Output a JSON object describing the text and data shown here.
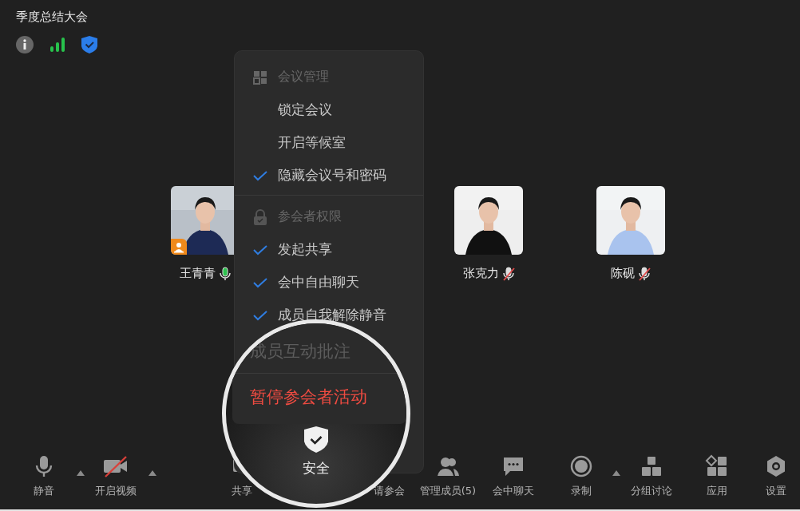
{
  "meeting": {
    "title": "季度总结大会"
  },
  "participants": [
    {
      "name": "王青青",
      "host": true,
      "muted": false
    },
    {
      "name": "张克力",
      "host": false,
      "muted": true
    },
    {
      "name": "陈砚",
      "host": false,
      "muted": true
    }
  ],
  "security_menu": {
    "sections": [
      {
        "kind": "grid",
        "header": "会议管理",
        "items": [
          {
            "label": "锁定会议",
            "checked": false
          },
          {
            "label": "开启等候室",
            "checked": false
          },
          {
            "label": "隐藏会议号和密码",
            "checked": true
          }
        ]
      },
      {
        "kind": "lock",
        "header": "参会者权限",
        "items": [
          {
            "label": "发起共享",
            "checked": true
          },
          {
            "label": "会中自由聊天",
            "checked": true
          },
          {
            "label": "成员自我解除静音",
            "checked": true
          }
        ]
      }
    ]
  },
  "magnifier": {
    "items": [
      {
        "label": "成员互动批注",
        "kind": "disabled"
      },
      {
        "label": "暂停参会者活动",
        "kind": "danger"
      }
    ],
    "button": {
      "label": "安全"
    }
  },
  "toolbar": {
    "left": [
      {
        "kind": "mic",
        "label": "静音",
        "caret": true
      },
      {
        "kind": "video-off",
        "label": "开启视频",
        "caret": true
      }
    ],
    "right": [
      {
        "kind": "share",
        "label": "共享",
        "caret": false
      },
      {
        "kind": "gap",
        "label": "请参会",
        "caret": false
      },
      {
        "kind": "members",
        "label": "管理成员(5)",
        "caret": false
      },
      {
        "kind": "chat",
        "label": "会中聊天",
        "caret": false
      },
      {
        "kind": "record",
        "label": "录制",
        "caret": true
      },
      {
        "kind": "breakout",
        "label": "分组讨论",
        "caret": false
      },
      {
        "kind": "apps",
        "label": "应用",
        "caret": false
      },
      {
        "kind": "settings",
        "label": "设置",
        "caret": false
      }
    ]
  }
}
